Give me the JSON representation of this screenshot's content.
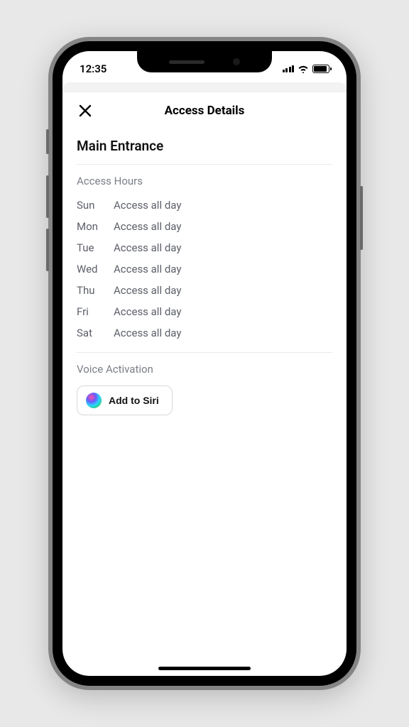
{
  "status": {
    "time": "12:35"
  },
  "modal": {
    "title": "Access Details"
  },
  "entrance": {
    "name": "Main Entrance"
  },
  "access_hours": {
    "label": "Access Hours",
    "rows": [
      {
        "day": "Sun",
        "value": "Access all day"
      },
      {
        "day": "Mon",
        "value": "Access all day"
      },
      {
        "day": "Tue",
        "value": "Access all day"
      },
      {
        "day": "Wed",
        "value": "Access all day"
      },
      {
        "day": "Thu",
        "value": "Access all day"
      },
      {
        "day": "Fri",
        "value": "Access all day"
      },
      {
        "day": "Sat",
        "value": "Access all day"
      }
    ]
  },
  "voice": {
    "label": "Voice Activation",
    "button": "Add to Siri"
  }
}
